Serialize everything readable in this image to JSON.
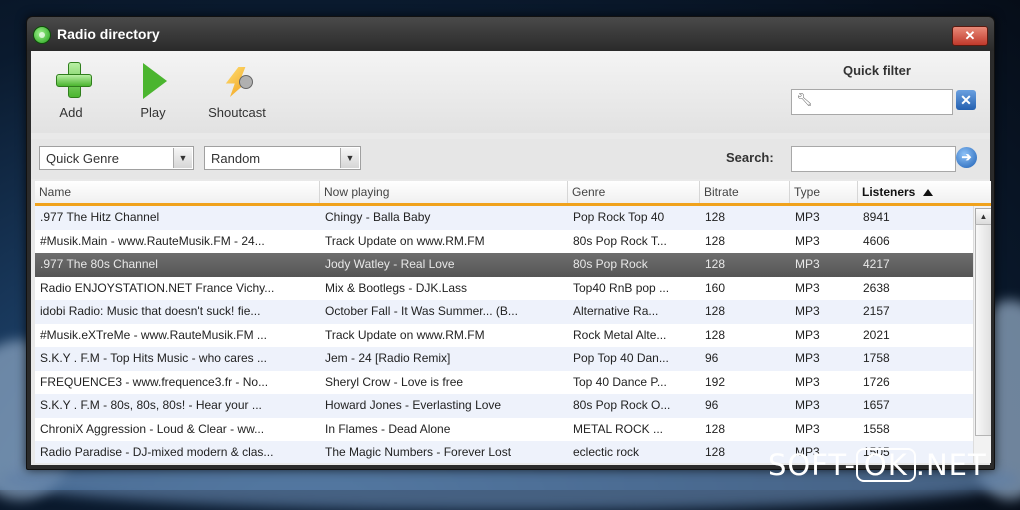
{
  "window": {
    "title": "Radio directory",
    "close_label": "✕"
  },
  "toolbar": {
    "add_label": "Add",
    "play_label": "Play",
    "shoutcast_label": "Shoutcast"
  },
  "quick_filter": {
    "label": "Quick filter",
    "value": "",
    "clear_label": "✕"
  },
  "filters": {
    "genre_value": "Quick Genre",
    "sort_value": "Random",
    "search_label": "Search:",
    "search_value": "",
    "go_label": "➔"
  },
  "table": {
    "columns": [
      "Name",
      "Now playing",
      "Genre",
      "Bitrate",
      "Type",
      "Listeners"
    ],
    "sorted_column": "Listeners",
    "sort_direction": "descending",
    "rows": [
      {
        "name": ".977 The Hitz Channel",
        "now_playing": "Chingy - Balla Baby",
        "genre": "Pop Rock Top 40",
        "bitrate": "128",
        "type": "MP3",
        "listeners": "8941"
      },
      {
        "name": "#Musik.Main - www.RauteMusik.FM - 24...",
        "now_playing": "Track Update on www.RM.FM",
        "genre": "80s Pop Rock T...",
        "bitrate": "128",
        "type": "MP3",
        "listeners": "4606"
      },
      {
        "name": ".977 The 80s Channel",
        "now_playing": "Jody Watley - Real Love",
        "genre": "80s Pop Rock",
        "bitrate": "128",
        "type": "MP3",
        "listeners": "4217"
      },
      {
        "name": "Radio ENJOYSTATION.NET France Vichy...",
        "now_playing": "Mix & Bootlegs - DJK.Lass",
        "genre": "Top40 RnB pop ...",
        "bitrate": "160",
        "type": "MP3",
        "listeners": "2638"
      },
      {
        "name": "idobi Radio: Music that doesn't suck! fie...",
        "now_playing": "October Fall - It Was Summer... (B...",
        "genre": "Alternative Ra...",
        "bitrate": "128",
        "type": "MP3",
        "listeners": "2157"
      },
      {
        "name": "#Musik.eXTreMe - www.RauteMusik.FM ...",
        "now_playing": "Track Update on www.RM.FM",
        "genre": "Rock Metal Alte...",
        "bitrate": "128",
        "type": "MP3",
        "listeners": "2021"
      },
      {
        "name": "S.K.Y . F.M - Top Hits Music - who cares ...",
        "now_playing": "Jem - 24 [Radio Remix]",
        "genre": "Pop Top 40 Dan...",
        "bitrate": "96",
        "type": "MP3",
        "listeners": "1758"
      },
      {
        "name": "FREQUENCE3 - www.frequence3.fr - No...",
        "now_playing": "Sheryl Crow - Love is free",
        "genre": "Top 40 Dance P...",
        "bitrate": "192",
        "type": "MP3",
        "listeners": "1726"
      },
      {
        "name": "S.K.Y . F.M - 80s, 80s, 80s! - Hear your ...",
        "now_playing": "Howard Jones - Everlasting Love",
        "genre": "80s Pop Rock O...",
        "bitrate": "96",
        "type": "MP3",
        "listeners": "1657"
      },
      {
        "name": "ChroniX Aggression - Loud & Clear - ww...",
        "now_playing": "In Flames - Dead Alone",
        "genre": "METAL ROCK ...",
        "bitrate": "128",
        "type": "MP3",
        "listeners": "1558"
      },
      {
        "name": "Radio Paradise - DJ-mixed modern & clas...",
        "now_playing": "The Magic Numbers - Forever Lost",
        "genre": "eclectic rock",
        "bitrate": "128",
        "type": "MP3",
        "listeners": "1505"
      }
    ],
    "selected_row": 2
  },
  "watermark": {
    "left": "SOFT-",
    "ok": "OK",
    "right": ".NET"
  }
}
